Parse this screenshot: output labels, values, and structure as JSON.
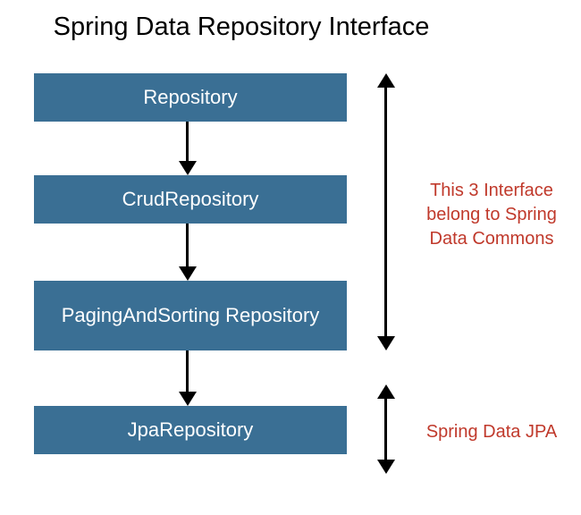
{
  "title": "Spring Data Repository Interface",
  "boxes": {
    "b1": "Repository",
    "b2": "CrudRepository",
    "b3": "PagingAndSorting Repository",
    "b4": "JpaRepository"
  },
  "annotations": {
    "commons": "This 3 Interface belong to Spring Data Commons",
    "jpa": "Spring Data JPA"
  },
  "colors": {
    "box_fill": "#3a6f94",
    "box_text": "#ffffff",
    "annotation_text": "#c0392b"
  }
}
